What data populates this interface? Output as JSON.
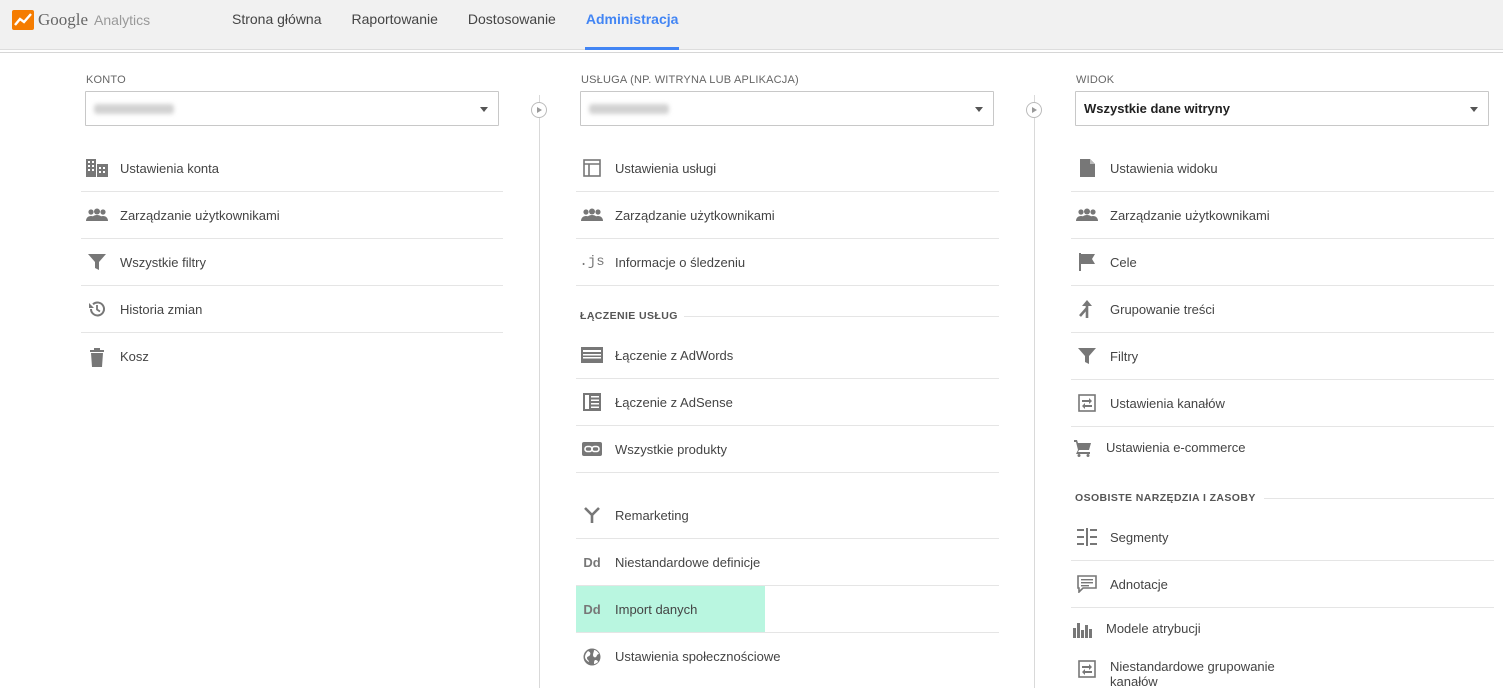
{
  "header": {
    "logo_google": "Google",
    "logo_analytics": "Analytics",
    "tabs": [
      {
        "label": "Strona główna",
        "active": false
      },
      {
        "label": "Raportowanie",
        "active": false
      },
      {
        "label": "Dostosowanie",
        "active": false
      },
      {
        "label": "Administracja",
        "active": true
      }
    ]
  },
  "colors": {
    "accent": "#4285f4",
    "highlight": "#b9f6e0",
    "icon": "#777777"
  },
  "account": {
    "label": "KONTO",
    "selected": "",
    "items": [
      {
        "label": "Ustawienia konta",
        "icon": "building-icon"
      },
      {
        "label": "Zarządzanie użytkownikami",
        "icon": "users-icon"
      },
      {
        "label": "Wszystkie filtry",
        "icon": "filter-icon"
      },
      {
        "label": "Historia zmian",
        "icon": "history-icon"
      },
      {
        "label": "Kosz",
        "icon": "trash-icon"
      }
    ]
  },
  "property": {
    "label": "USŁUGA (NP. WITRYNA LUB APLIKACJA)",
    "selected": "",
    "items": [
      {
        "label": "Ustawienia usługi",
        "icon": "window-icon"
      },
      {
        "label": "Zarządzanie użytkownikami",
        "icon": "users-icon"
      },
      {
        "label": "Informacje o śledzeniu",
        "icon": "js-icon"
      }
    ],
    "section": "ŁĄCZENIE USŁUG",
    "link_items": [
      {
        "label": "Łączenie z AdWords",
        "icon": "adwords-icon"
      },
      {
        "label": "Łączenie z AdSense",
        "icon": "adsense-icon"
      },
      {
        "label": "Wszystkie produkty",
        "icon": "link-icon"
      }
    ],
    "other_items": [
      {
        "label": "Remarketing",
        "icon": "remarketing-icon"
      },
      {
        "label": "Niestandardowe definicje",
        "icon": "dd-icon"
      },
      {
        "label": "Import danych",
        "icon": "dd-icon",
        "highlighted": true
      },
      {
        "label": "Ustawienia społecznościowe",
        "icon": "globe-icon"
      }
    ],
    "dd_text": "Dd",
    "js_text": ".js"
  },
  "view": {
    "label": "WIDOK",
    "selected": "Wszystkie dane witryny",
    "items": [
      {
        "label": "Ustawienia widoku",
        "icon": "document-icon"
      },
      {
        "label": "Zarządzanie użytkownikami",
        "icon": "users-icon"
      },
      {
        "label": "Cele",
        "icon": "flag-icon"
      },
      {
        "label": "Grupowanie treści",
        "icon": "merge-icon"
      },
      {
        "label": "Filtry",
        "icon": "filter-icon"
      },
      {
        "label": "Ustawienia kanałów",
        "icon": "channels-icon"
      },
      {
        "label": "Ustawienia e-commerce",
        "icon": "cart-icon"
      }
    ],
    "section": "OSOBISTE NARZĘDZIA I ZASOBY",
    "personal_items": [
      {
        "label": "Segmenty",
        "icon": "segments-icon"
      },
      {
        "label": "Adnotacje",
        "icon": "annotation-icon"
      },
      {
        "label": "Modele atrybucji",
        "icon": "bars-icon"
      },
      {
        "label": "Niestandardowe grupowanie kanałów",
        "icon": "channels-icon"
      }
    ]
  }
}
